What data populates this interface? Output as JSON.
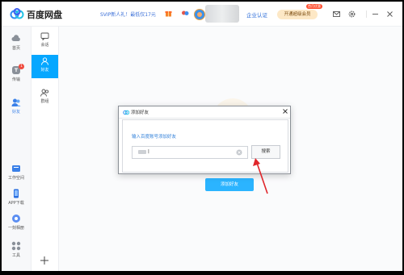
{
  "titlebar": {
    "app_name": "百度网盘",
    "promo_text": "SVIP新人礼！最低仅17元",
    "verify_label": "企业认证",
    "member_button": "开通超级会员",
    "member_tag": "首月优惠"
  },
  "sidebar": {
    "items": [
      {
        "label": "首页",
        "icon": "cloud-icon"
      },
      {
        "label": "传输",
        "icon": "transfer-icon",
        "badge": "1"
      },
      {
        "label": "好友",
        "icon": "friends-icon",
        "active": true
      },
      {
        "label": "工作空间",
        "icon": "workspace-icon"
      },
      {
        "label": "APP下载",
        "icon": "phone-icon"
      },
      {
        "label": "一刻相册",
        "icon": "album-icon"
      },
      {
        "label": "工具",
        "icon": "tools-icon"
      }
    ]
  },
  "subnav": {
    "items": [
      {
        "label": "会话",
        "icon": "chat-icon"
      },
      {
        "label": "好友",
        "icon": "friend-icon",
        "active": true
      },
      {
        "label": "群组",
        "icon": "group-icon"
      }
    ]
  },
  "main": {
    "add_friend_button": "添加好友"
  },
  "dialog": {
    "title": "添加好友",
    "prompt": "输入百度账号添加好友",
    "input_value": "|",
    "search_button": "搜索"
  },
  "colors": {
    "accent": "#06a7ff",
    "link": "#2f7fd9",
    "arrow": "#e0262b"
  }
}
